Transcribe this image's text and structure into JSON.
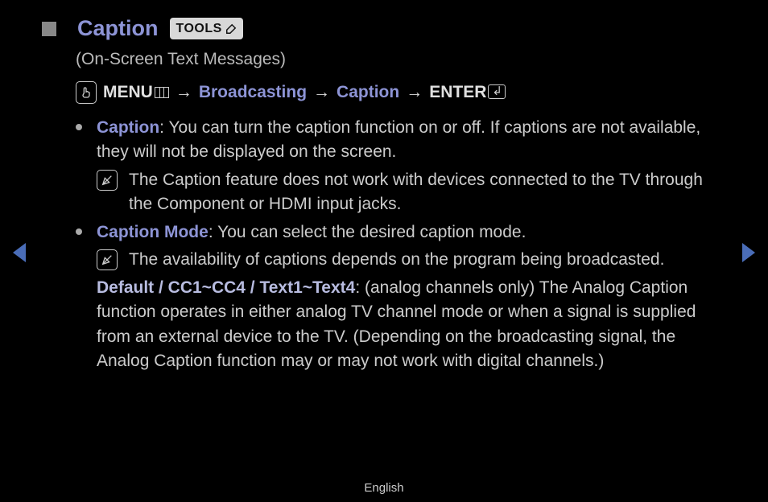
{
  "header": {
    "title": "Caption",
    "tools_label": "TOOLS",
    "subtitle": "(On-Screen Text Messages)"
  },
  "nav": {
    "menu": "MENU",
    "arrow": "→",
    "broadcasting": "Broadcasting",
    "caption": "Caption",
    "enter": "ENTER"
  },
  "items": [
    {
      "term": "Caption",
      "desc": ": You can turn the caption function on or off. If captions are not available, they will not be displayed on the screen.",
      "note": "The Caption feature does not work with devices connected to the TV through the Component or HDMI input jacks."
    },
    {
      "term": "Caption Mode",
      "desc": ": You can select the desired caption mode.",
      "note": "The availability of captions depends on the program being broadcasted.",
      "sub_term": "Default / CC1~CC4 / Text1~Text4",
      "sub_desc": ": (analog channels only) The Analog Caption function operates in either analog TV channel mode or when a signal is supplied from an external device to the TV. (Depending on the broadcasting signal, the Analog Caption function may or may not work with digital channels.)"
    }
  ],
  "footer": {
    "language": "English"
  }
}
